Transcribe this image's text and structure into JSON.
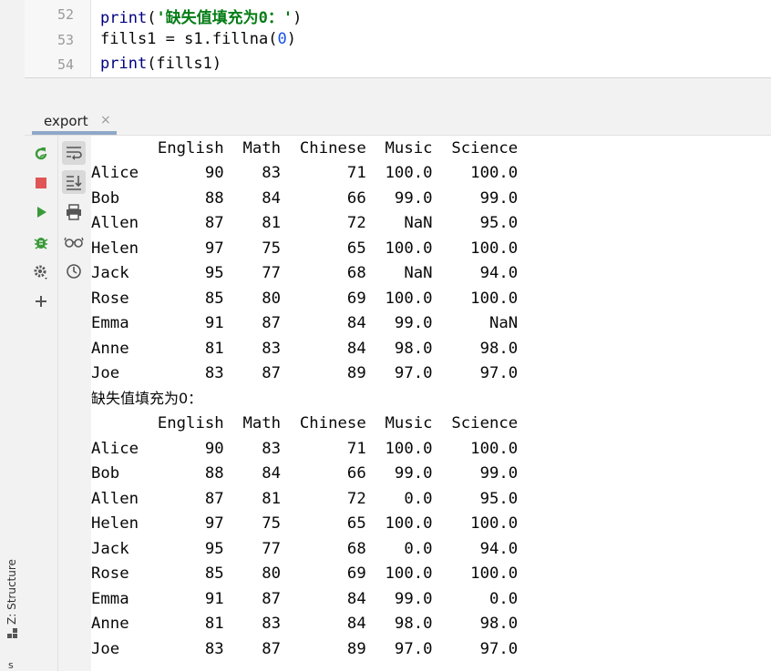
{
  "editor": {
    "lines": [
      {
        "number": "52",
        "code": "print('缺失值填充为0：')"
      },
      {
        "number": "53",
        "code": "fills1 = s1.fillna(0)"
      },
      {
        "number": "54",
        "code": "print(fills1)"
      }
    ]
  },
  "run_panel": {
    "tab_label": "export",
    "tab_close": "×"
  },
  "left_tool_window": {
    "structure_label": "Z: Structure",
    "bottom_label": "s"
  },
  "toolbar_left_icons": [
    "rerun-icon",
    "stop-icon",
    "run-icon",
    "debug-icon",
    "settings-icon",
    "add-icon"
  ],
  "toolbar_right_icons": [
    "soft-wrap-icon",
    "scroll-to-end-icon",
    "print-icon",
    "glasses-icon",
    "history-icon"
  ],
  "console": {
    "lines": [
      "       English  Math  Chinese  Music  Science",
      "Alice       90    83       71  100.0    100.0",
      "Bob         88    84       66   99.0     99.0",
      "Allen       87    81       72    NaN     95.0",
      "Helen       97    75       65  100.0    100.0",
      "Jack        95    77       68    NaN     94.0",
      "Rose        85    80       69  100.0    100.0",
      "Emma        91    87       84   99.0      NaN",
      "Anne        81    83       84   98.0     98.0",
      "Joe         83    87       89   97.0     97.0",
      "缺失值填充为0：",
      "       English  Math  Chinese  Music  Science",
      "Alice       90    83       71  100.0    100.0",
      "Bob         88    84       66   99.0     99.0",
      "Allen       87    81       72    0.0     95.0",
      "Helen       97    75       65  100.0    100.0",
      "Jack        95    77       68    0.0     94.0",
      "Rose        85    80       69  100.0    100.0",
      "Emma        91    87       84   99.0      0.0",
      "Anne        81    83       84   98.0     98.0",
      "Joe         83    87       89   97.0     97.0"
    ]
  },
  "colors": {
    "function": "#000080",
    "string": "#067d17",
    "number": "#1750eb",
    "rerun": "#3a9a3a",
    "stop": "#e05555",
    "run": "#3a9a3a",
    "debug": "#3a9a3a"
  }
}
